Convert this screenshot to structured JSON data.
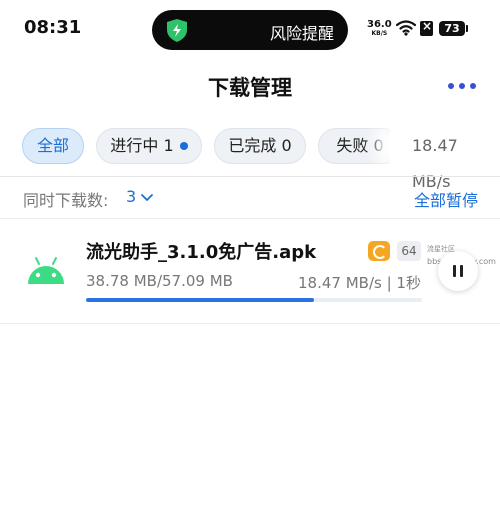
{
  "status_bar": {
    "time": "08:31",
    "island_text": "风险提醒",
    "net_speed": "36.0",
    "net_unit": "KB/S",
    "battery": "73",
    "icons": [
      "shield-check-icon",
      "wifi-icon",
      "no-sim-icon",
      "battery-icon"
    ]
  },
  "header": {
    "title": "下载管理",
    "more_icon": "more-dots-icon"
  },
  "tabs": [
    {
      "label": "全部",
      "active": true
    },
    {
      "label": "进行中 1",
      "active": false,
      "has_dot": true
    },
    {
      "label": "已完成 0",
      "active": false
    },
    {
      "label": "失败 0",
      "active": false
    }
  ],
  "total_speed": "18.47 MB/s",
  "concurrent": {
    "label": "同时下载数:",
    "value": "3",
    "pause_all": "全部暂停"
  },
  "downloads": [
    {
      "icon": "android-icon",
      "name": "流光助手_3.1.0免广告.apk",
      "badge_count": "64",
      "size": "38.78 MB/57.09 MB",
      "rate": "18.47 MB/s | 1秒",
      "progress": 0.679
    }
  ],
  "watermark": {
    "line1": "流星社区",
    "line2": "bbs.liuxingw.com"
  },
  "colors": {
    "accent": "#1a6fd8",
    "progress": "#2a72e0",
    "tab_active_bg": "#dcebfb"
  }
}
